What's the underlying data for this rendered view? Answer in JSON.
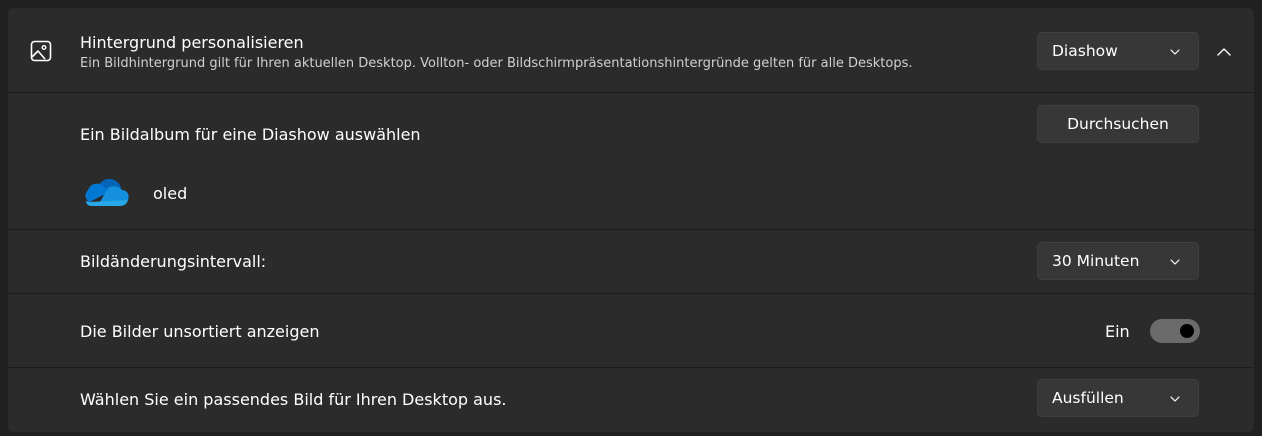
{
  "header": {
    "icon": "image-icon",
    "title": "Hintergrund personalisieren",
    "subtitle": "Ein Bildhintergrund gilt für Ihren aktuellen Desktop. Vollton- oder Bildschirmpräsentationshintergründe gelten für alle Desktops.",
    "dropdown_value": "Diashow",
    "collapse_icon": "chevron-up-icon"
  },
  "album": {
    "label": "Ein Bildalbum für eine Diashow auswählen",
    "browse_button": "Durchsuchen",
    "selected_icon": "onedrive-icon",
    "selected_name": "oled"
  },
  "interval": {
    "label": "Bildänderungsintervall:",
    "value": "30 Minuten"
  },
  "shuffle": {
    "label": "Die Bilder unsortiert anzeigen",
    "state_label": "Ein",
    "on": true
  },
  "fit": {
    "label": "Wählen Sie ein passendes Bild für Ihren Desktop aus.",
    "value": "Ausfüllen"
  },
  "colors": {
    "background": "#202020",
    "card": "#2b2b2b",
    "control": "#373737",
    "onedrive_dark": "#0364b8",
    "onedrive_light": "#28a8ea"
  }
}
